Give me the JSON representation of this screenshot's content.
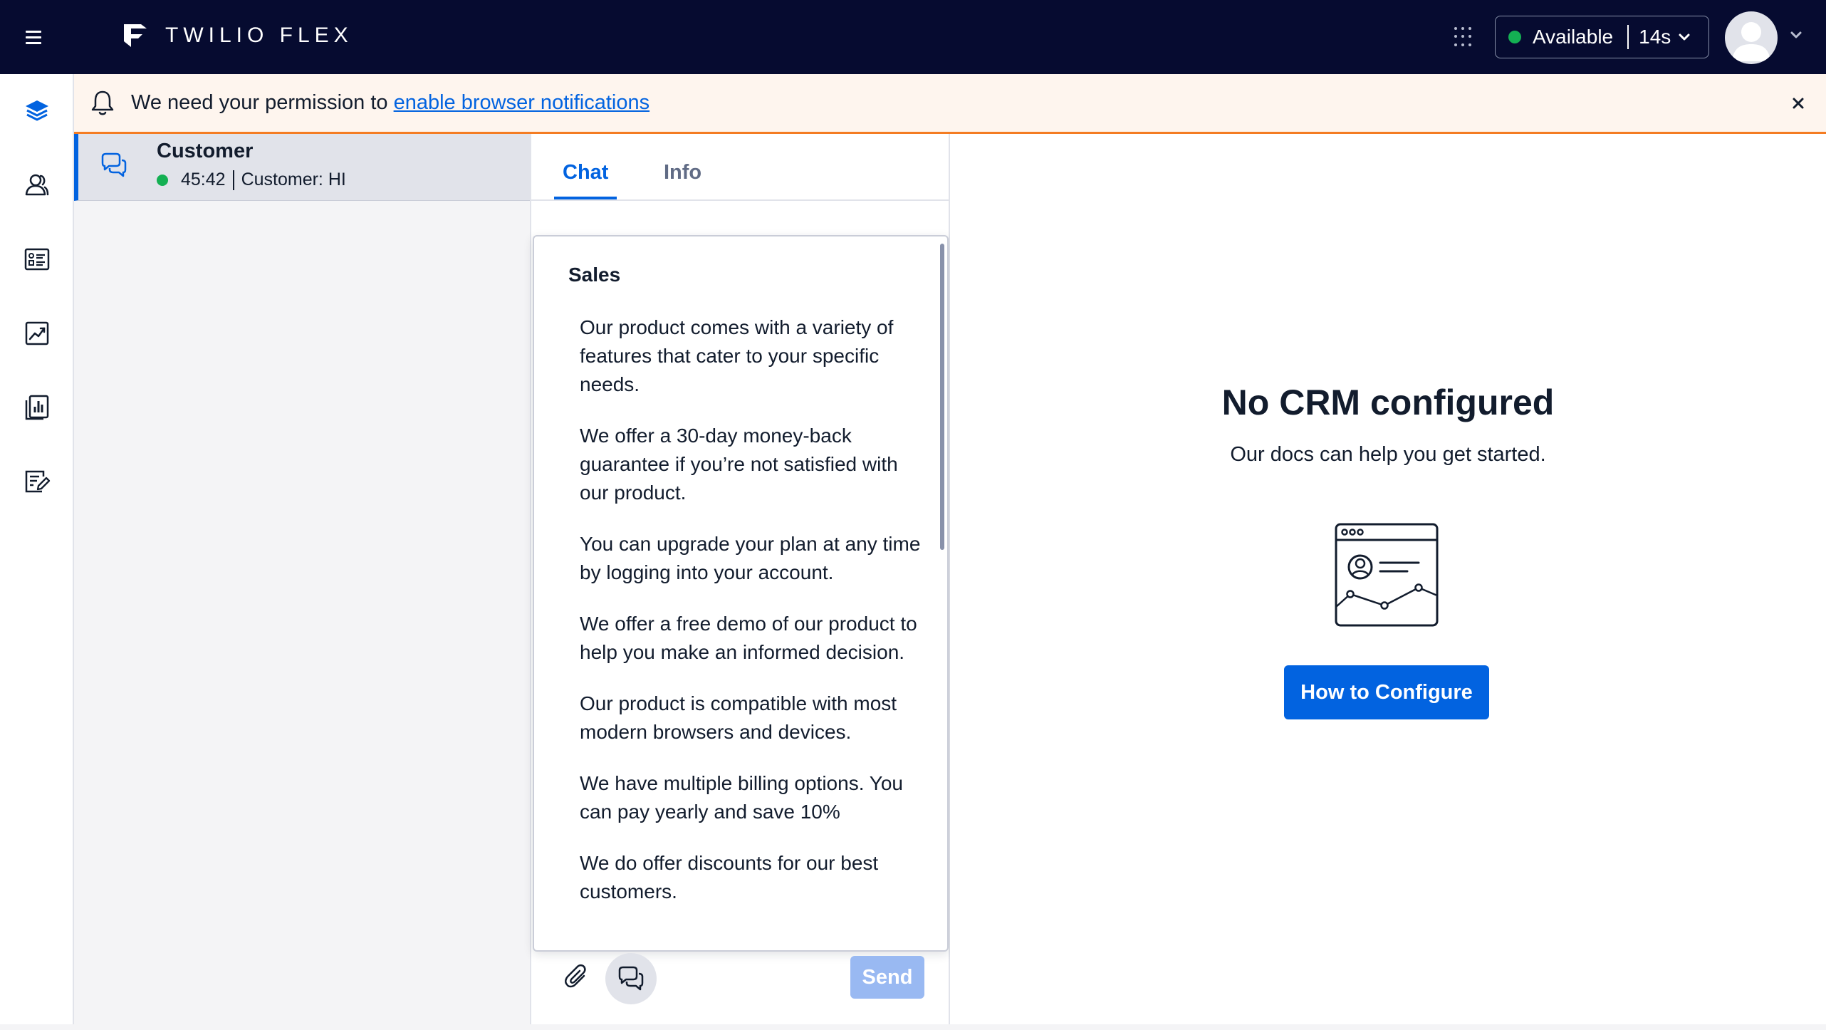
{
  "app": {
    "brand": "TWILIO FLEX"
  },
  "header": {
    "status_label": "Available",
    "status_timer": "14s",
    "status_color": "#14b053"
  },
  "rail": {
    "items": [
      {
        "name": "agent-desktop",
        "icon": "layers-icon"
      },
      {
        "name": "teams",
        "icon": "users-icon"
      },
      {
        "name": "queues-stats",
        "icon": "list-card-icon"
      },
      {
        "name": "insights",
        "icon": "trend-chart-icon"
      },
      {
        "name": "analytics",
        "icon": "bar-report-icon"
      },
      {
        "name": "quality-management",
        "icon": "edit-list-icon"
      }
    ]
  },
  "banner": {
    "text": "We need your permission to ",
    "link_text": "enable browser notifications"
  },
  "task": {
    "title": "Customer",
    "time": "45:42",
    "preview": "Customer: HI"
  },
  "tabs": [
    {
      "label": "Chat"
    },
    {
      "label": "Info"
    }
  ],
  "canned_responses": {
    "category": "Sales",
    "items": [
      "Our product comes with a variety of features that cater to your specific needs.",
      "We offer a 30-day money-back guarantee if you’re not satisfied with our product.",
      "You can upgrade your plan at any time by logging into your account.",
      "We offer a free demo of our product to help you make an informed decision.",
      "Our product is compatible with most modern browsers and devices.",
      "We have multiple billing options. You can pay yearly and save 10%",
      "We do offer discounts for our best customers."
    ]
  },
  "composer": {
    "send_label": "Send"
  },
  "crm": {
    "title": "No CRM configured",
    "subtitle": "Our docs can help you get started.",
    "button_label": "How to Configure"
  },
  "colors": {
    "topbar": "#060b30",
    "primary": "#0263e0",
    "banner_bg": "#fef5ee",
    "banner_border": "#f47c22"
  }
}
